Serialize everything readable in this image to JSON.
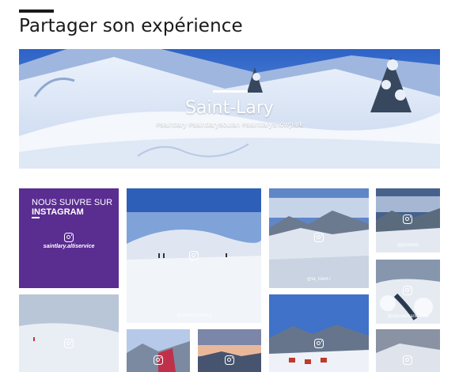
{
  "page": {
    "title": "Partager son expérience"
  },
  "hero": {
    "title": "Saint-Lary",
    "hashtags": "#saintlary #saintlarysoulan #saintlarysnowpark"
  },
  "instagram_promo": {
    "line1": "NOUS SUIVRE SUR",
    "line2": "INSTAGRAM",
    "account": "saintlary.altiservice",
    "icon": "instagram-icon"
  },
  "tiles": [
    {
      "handle": "@lauremarvaing"
    },
    {
      "handle": "@la_tole47"
    },
    {
      "handle": "@psmabo"
    },
    {
      "handle": "@camillefrancouna"
    },
    {
      "handle": ""
    },
    {
      "handle": ""
    },
    {
      "handle": ""
    },
    {
      "handle": ""
    },
    {
      "handle": ""
    }
  ],
  "colors": {
    "promo_purple": "#5a2d91",
    "title_text": "#1a1a1a"
  }
}
